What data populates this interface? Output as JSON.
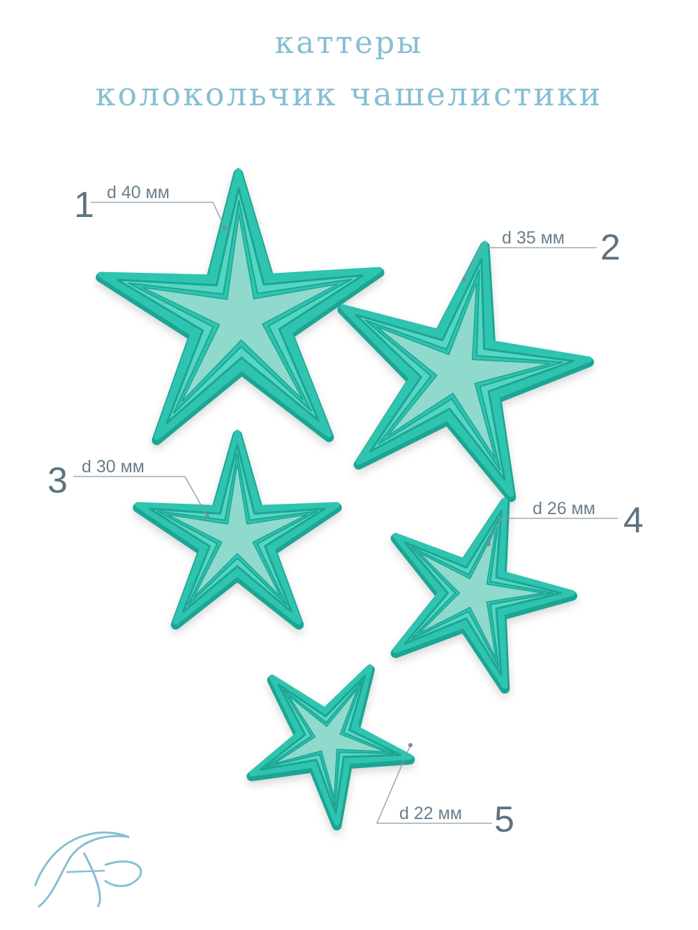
{
  "title": {
    "line1": "каттеры",
    "line2": "колокольчик чашелистики"
  },
  "cutters": [
    {
      "number": "1",
      "label": "d 40 мм"
    },
    {
      "number": "2",
      "label": "d 35 мм"
    },
    {
      "number": "3",
      "label": "d 30 мм"
    },
    {
      "number": "4",
      "label": "d 26 мм"
    },
    {
      "number": "5",
      "label": "d 22 мм"
    }
  ],
  "logo": "FP",
  "colors": {
    "cutter": "#2ec4b0",
    "cutter_dark": "#1fa593",
    "cutter_light": "#55d6c4",
    "title": "#86bfd4",
    "text": "#5d7382"
  }
}
